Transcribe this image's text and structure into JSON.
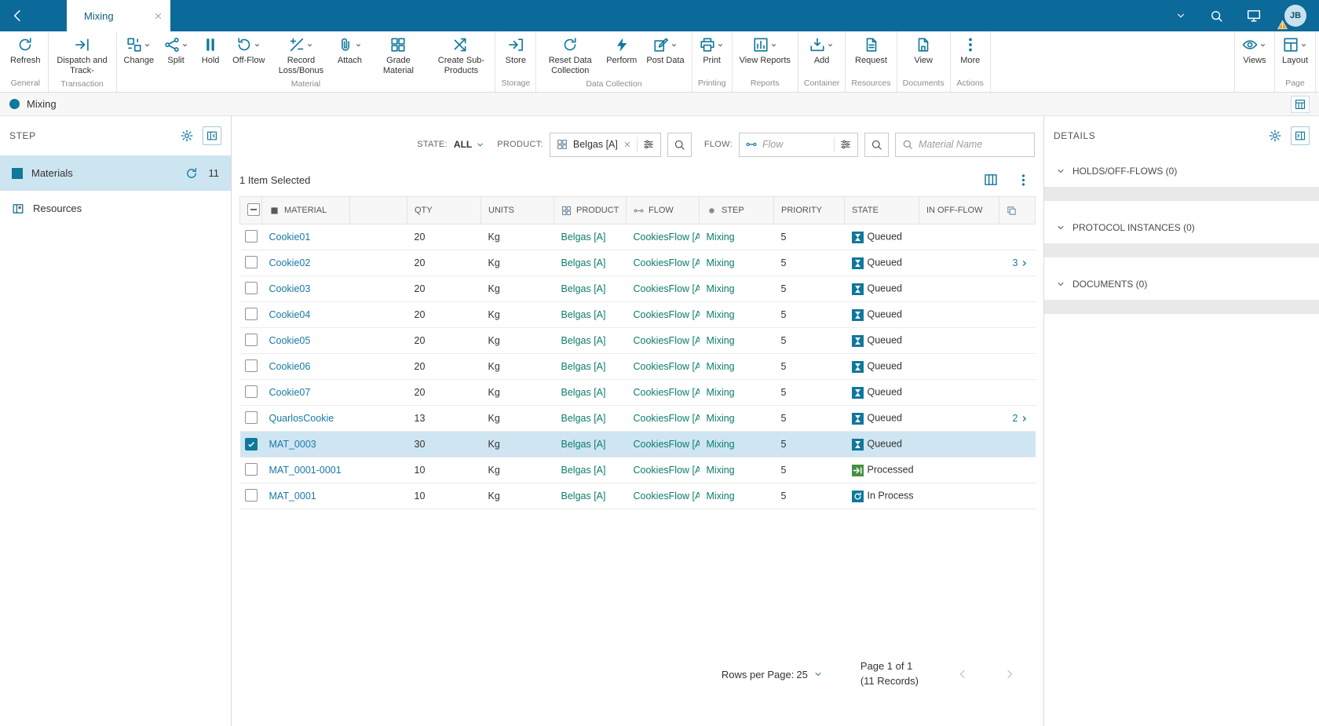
{
  "topbar": {
    "tab_label": "Mixing",
    "avatar_initials": "JB"
  },
  "breadcrumb": {
    "label": "Mixing"
  },
  "ribbon": {
    "groups": [
      {
        "label": "General",
        "buttons": [
          {
            "label": "Refresh",
            "icon": "refresh",
            "dropdown": false
          }
        ]
      },
      {
        "label": "Transaction",
        "buttons": [
          {
            "label": "Dispatch and Track-",
            "icon": "dispatch",
            "dropdown": false
          }
        ]
      },
      {
        "label": "Material",
        "buttons": [
          {
            "label": "Change",
            "icon": "change",
            "dropdown": true
          },
          {
            "label": "Split",
            "icon": "split",
            "dropdown": true
          },
          {
            "label": "Hold",
            "icon": "hold",
            "dropdown": false
          },
          {
            "label": "Off-Flow",
            "icon": "offflow",
            "dropdown": true
          },
          {
            "label": "Record Loss/Bonus",
            "icon": "recordloss",
            "dropdown": true
          },
          {
            "label": "Attach",
            "icon": "attach",
            "dropdown": true
          },
          {
            "label": "Grade Material",
            "icon": "grade",
            "dropdown": false
          },
          {
            "label": "Create Sub-Products",
            "icon": "subproducts",
            "dropdown": false
          }
        ]
      },
      {
        "label": "Storage",
        "buttons": [
          {
            "label": "Store",
            "icon": "store",
            "dropdown": false
          }
        ]
      },
      {
        "label": "Data Collection",
        "buttons": [
          {
            "label": "Reset Data Collection",
            "icon": "refresh",
            "dropdown": false
          },
          {
            "label": "Perform",
            "icon": "perform",
            "dropdown": false
          },
          {
            "label": "Post Data",
            "icon": "postdata",
            "dropdown": true
          }
        ]
      },
      {
        "label": "Printing",
        "buttons": [
          {
            "label": "Print",
            "icon": "print",
            "dropdown": true
          }
        ]
      },
      {
        "label": "Reports",
        "buttons": [
          {
            "label": "View Reports",
            "icon": "reports",
            "dropdown": true
          }
        ]
      },
      {
        "label": "Container",
        "buttons": [
          {
            "label": "Add",
            "icon": "container",
            "dropdown": true
          }
        ]
      },
      {
        "label": "Resources",
        "buttons": [
          {
            "label": "Request",
            "icon": "request",
            "dropdown": false
          }
        ]
      },
      {
        "label": "Documents",
        "buttons": [
          {
            "label": "View",
            "icon": "viewdoc",
            "dropdown": false
          }
        ]
      },
      {
        "label": "Actions",
        "buttons": [
          {
            "label": "More",
            "icon": "more",
            "dropdown": false
          }
        ]
      }
    ],
    "right_groups": [
      {
        "label": "",
        "buttons": [
          {
            "label": "Views",
            "icon": "views",
            "dropdown": true
          }
        ]
      },
      {
        "label": "Page",
        "buttons": [
          {
            "label": "Layout",
            "icon": "layout",
            "dropdown": true
          }
        ]
      }
    ]
  },
  "sidebar": {
    "title": "STEP",
    "items": [
      {
        "label": "Materials",
        "count": "11",
        "selected": true
      },
      {
        "label": "Resources",
        "selected": false
      }
    ]
  },
  "filters": {
    "state_label": "STATE:",
    "state_value": "ALL",
    "product_label": "PRODUCT:",
    "product_value": "Belgas [A]",
    "flow_label": "FLOW:",
    "flow_placeholder": "Flow",
    "material_placeholder": "Material Name"
  },
  "selection_text": "1 Item Selected",
  "table": {
    "columns": [
      "",
      "MATERIAL",
      "",
      "QTY",
      "UNITS",
      "PRODUCT",
      "FLOW",
      "STEP",
      "PRIORITY",
      "STATE",
      "IN OFF-FLOW",
      ""
    ],
    "rows": [
      {
        "material": "Cookie01",
        "qty": "20",
        "units": "Kg",
        "product": "Belgas [A]",
        "flow": "CookiesFlow [A",
        "step": "Mixing",
        "priority": "5",
        "state": "Queued",
        "state_type": "queued",
        "count": "",
        "checked": false
      },
      {
        "material": "Cookie02",
        "qty": "20",
        "units": "Kg",
        "product": "Belgas [A]",
        "flow": "CookiesFlow [A",
        "step": "Mixing",
        "priority": "5",
        "state": "Queued",
        "state_type": "queued",
        "count": "3",
        "checked": false
      },
      {
        "material": "Cookie03",
        "qty": "20",
        "units": "Kg",
        "product": "Belgas [A]",
        "flow": "CookiesFlow [A",
        "step": "Mixing",
        "priority": "5",
        "state": "Queued",
        "state_type": "queued",
        "count": "",
        "checked": false
      },
      {
        "material": "Cookie04",
        "qty": "20",
        "units": "Kg",
        "product": "Belgas [A]",
        "flow": "CookiesFlow [A",
        "step": "Mixing",
        "priority": "5",
        "state": "Queued",
        "state_type": "queued",
        "count": "",
        "checked": false
      },
      {
        "material": "Cookie05",
        "qty": "20",
        "units": "Kg",
        "product": "Belgas [A]",
        "flow": "CookiesFlow [A",
        "step": "Mixing",
        "priority": "5",
        "state": "Queued",
        "state_type": "queued",
        "count": "",
        "checked": false
      },
      {
        "material": "Cookie06",
        "qty": "20",
        "units": "Kg",
        "product": "Belgas [A]",
        "flow": "CookiesFlow [A",
        "step": "Mixing",
        "priority": "5",
        "state": "Queued",
        "state_type": "queued",
        "count": "",
        "checked": false
      },
      {
        "material": "Cookie07",
        "qty": "20",
        "units": "Kg",
        "product": "Belgas [A]",
        "flow": "CookiesFlow [A",
        "step": "Mixing",
        "priority": "5",
        "state": "Queued",
        "state_type": "queued",
        "count": "",
        "checked": false
      },
      {
        "material": "QuarlosCookie",
        "qty": "13",
        "units": "Kg",
        "product": "Belgas [A]",
        "flow": "CookiesFlow [A",
        "step": "Mixing",
        "priority": "5",
        "state": "Queued",
        "state_type": "queued",
        "count": "2",
        "checked": false
      },
      {
        "material": "MAT_0003",
        "qty": "30",
        "units": "Kg",
        "product": "Belgas [A]",
        "flow": "CookiesFlow [A",
        "step": "Mixing",
        "priority": "5",
        "state": "Queued",
        "state_type": "queued",
        "count": "",
        "checked": true
      },
      {
        "material": "MAT_0001-0001",
        "qty": "10",
        "units": "Kg",
        "product": "Belgas [A]",
        "flow": "CookiesFlow [A",
        "step": "Mixing",
        "priority": "5",
        "state": "Processed",
        "state_type": "processed",
        "count": "",
        "checked": false
      },
      {
        "material": "MAT_0001",
        "qty": "10",
        "units": "Kg",
        "product": "Belgas [A]",
        "flow": "CookiesFlow [A",
        "step": "Mixing",
        "priority": "5",
        "state": "In Process",
        "state_type": "inprocess",
        "count": "",
        "checked": false
      }
    ]
  },
  "pagination": {
    "rows_per_page_label": "Rows per Page:",
    "rows_per_page": "25",
    "page_text": "Page 1 of 1",
    "records_text": "(11 Records)"
  },
  "details": {
    "title": "DETAILS",
    "sections": [
      {
        "label": "HOLDS/OFF-FLOWS (0)"
      },
      {
        "label": "PROTOCOL INSTANCES (0)"
      },
      {
        "label": "DOCUMENTS (0)"
      }
    ]
  }
}
